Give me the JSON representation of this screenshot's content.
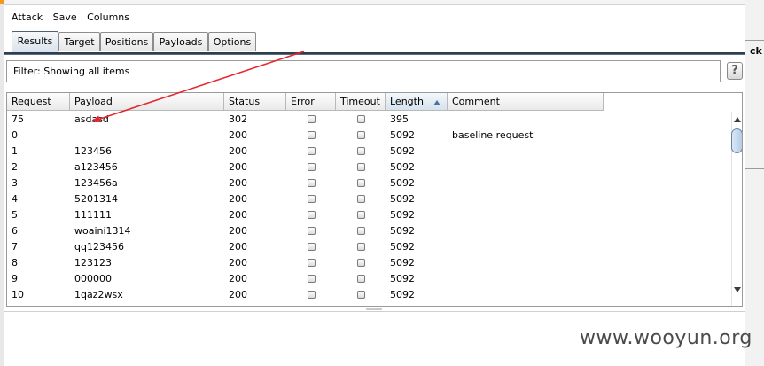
{
  "menu": [
    "Attack",
    "Save",
    "Columns"
  ],
  "tabs": [
    {
      "label": "Results",
      "active": true
    },
    {
      "label": "Target",
      "active": false
    },
    {
      "label": "Positions",
      "active": false
    },
    {
      "label": "Payloads",
      "active": false
    },
    {
      "label": "Options",
      "active": false
    }
  ],
  "filter": {
    "text": "Filter:  Showing all items"
  },
  "help": {
    "label": "?"
  },
  "table": {
    "columns": [
      "Request",
      "Payload",
      "Status",
      "Error",
      "Timeout",
      "Length",
      "Comment"
    ],
    "sorted_column": "Length",
    "rows": [
      {
        "request": "75",
        "payload": "asdasd",
        "status": "302",
        "length": "395",
        "comment": ""
      },
      {
        "request": "0",
        "payload": "",
        "status": "200",
        "length": "5092",
        "comment": "baseline request"
      },
      {
        "request": "1",
        "payload": "123456",
        "status": "200",
        "length": "5092",
        "comment": ""
      },
      {
        "request": "2",
        "payload": "a123456",
        "status": "200",
        "length": "5092",
        "comment": ""
      },
      {
        "request": "3",
        "payload": "123456a",
        "status": "200",
        "length": "5092",
        "comment": ""
      },
      {
        "request": "4",
        "payload": "5201314",
        "status": "200",
        "length": "5092",
        "comment": ""
      },
      {
        "request": "5",
        "payload": "111111",
        "status": "200",
        "length": "5092",
        "comment": ""
      },
      {
        "request": "6",
        "payload": "woaini1314",
        "status": "200",
        "length": "5092",
        "comment": ""
      },
      {
        "request": "7",
        "payload": "qq123456",
        "status": "200",
        "length": "5092",
        "comment": ""
      },
      {
        "request": "8",
        "payload": "123123",
        "status": "200",
        "length": "5092",
        "comment": ""
      },
      {
        "request": "9",
        "payload": "000000",
        "status": "200",
        "length": "5092",
        "comment": ""
      },
      {
        "request": "10",
        "payload": "1qaz2wsx",
        "status": "200",
        "length": "5092",
        "comment": ""
      }
    ]
  },
  "background": {
    "right_label": "ck"
  },
  "watermark": "www.wooyun.org",
  "colors": {
    "annotation_arrow": "#e8262b",
    "tab_accent": "#2f3e4e",
    "sort_arrow": "#4872a0"
  }
}
